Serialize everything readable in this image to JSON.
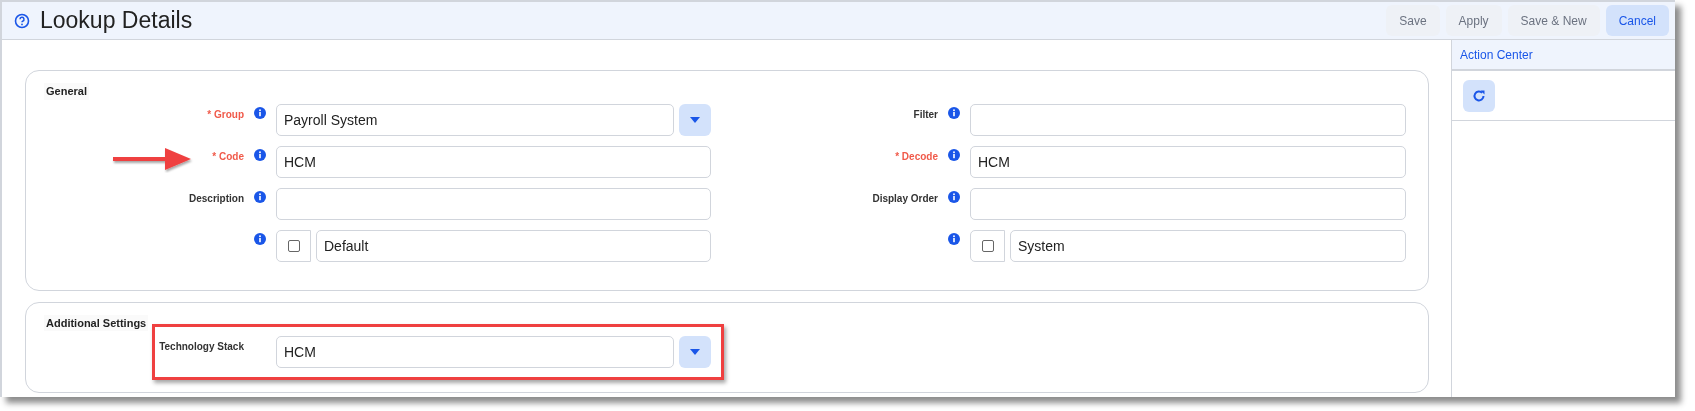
{
  "header": {
    "title": "Lookup Details",
    "buttons": [
      {
        "label": "Save",
        "primary": false
      },
      {
        "label": "Apply",
        "primary": false
      },
      {
        "label": "Save & New",
        "primary": false
      },
      {
        "label": "Cancel",
        "primary": true
      }
    ]
  },
  "sections": [
    {
      "title": "General",
      "columns": [
        [
          {
            "kind": "select",
            "label": "* Group",
            "required": true,
            "value": "Payroll System"
          },
          {
            "kind": "text",
            "label": "* Code",
            "required": true,
            "value": "HCM",
            "pointer_arrow": true
          },
          {
            "kind": "text",
            "label": "Description",
            "required": false
          },
          {
            "kind": "checkbox",
            "checked": false,
            "value": "Default"
          }
        ],
        [
          {
            "kind": "text",
            "label": "Filter",
            "required": false
          },
          {
            "kind": "text",
            "label": "* Decode",
            "required": true,
            "value": "HCM"
          },
          {
            "kind": "text",
            "label": "Display Order",
            "required": false
          },
          {
            "kind": "checkbox",
            "checked": false,
            "value": "System"
          }
        ]
      ]
    },
    {
      "title": "Additional Settings",
      "columns": [
        [
          {
            "kind": "select",
            "label": "Technology Stack",
            "required": false,
            "value": "HCM",
            "highlighted": true
          }
        ]
      ]
    }
  ],
  "action_center": {
    "title": "Action Center"
  }
}
